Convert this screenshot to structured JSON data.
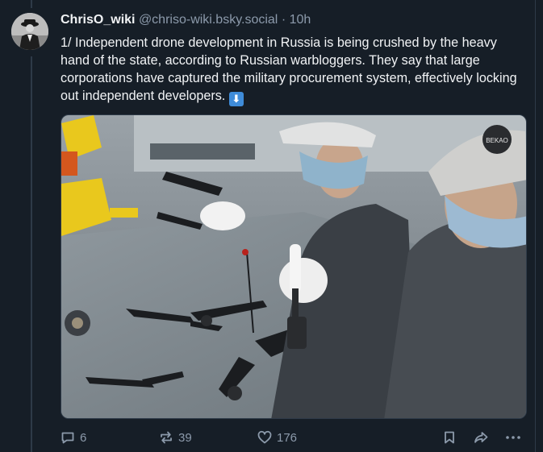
{
  "post": {
    "display_name": "ChrisO_wiki",
    "handle": "@chriso-wiki.bsky.social",
    "separator": "·",
    "time": "10h",
    "text": "1/ Independent drone development in Russia is being crushed by the heavy hand of the state, according to Russian warbloggers. They say that large corporations have captured the military procurement system, effectively locking out independent developers.",
    "emoji": "⬇",
    "image_badge": "BEKAO"
  },
  "actions": {
    "replies": "6",
    "reposts": "39",
    "likes": "176"
  },
  "icons": {
    "reply": "reply-icon",
    "repost": "repost-icon",
    "like": "heart-icon",
    "bookmark": "bookmark-icon",
    "share": "share-icon",
    "more": "more-icon"
  },
  "colors": {
    "background": "#161e27",
    "muted": "#8c9aab",
    "text": "#f1f3f5",
    "border": "#2e3a48"
  }
}
